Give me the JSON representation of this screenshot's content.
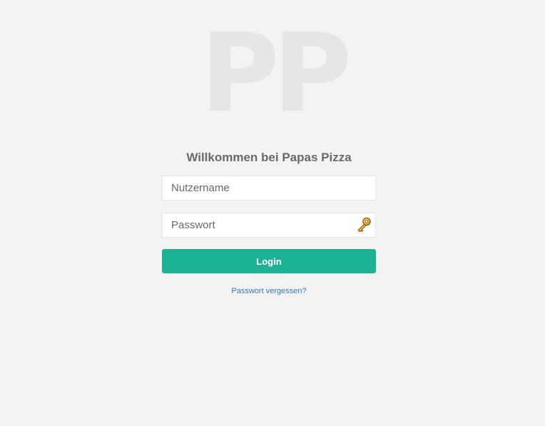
{
  "logo": {
    "text": "PP"
  },
  "welcome": {
    "title": "Willkommen bei Papas Pizza"
  },
  "form": {
    "username_placeholder": "Nutzername",
    "username_value": "",
    "password_placeholder": "Passwort",
    "password_value": "",
    "password_icon": "key-icon",
    "login_label": "Login",
    "forgot_label": "Passwort vergessen?"
  },
  "colors": {
    "background": "#f3f3f4",
    "accent": "#1ab394",
    "link": "#337ab7",
    "logo": "#e6e6e6",
    "text": "#676a6c"
  }
}
